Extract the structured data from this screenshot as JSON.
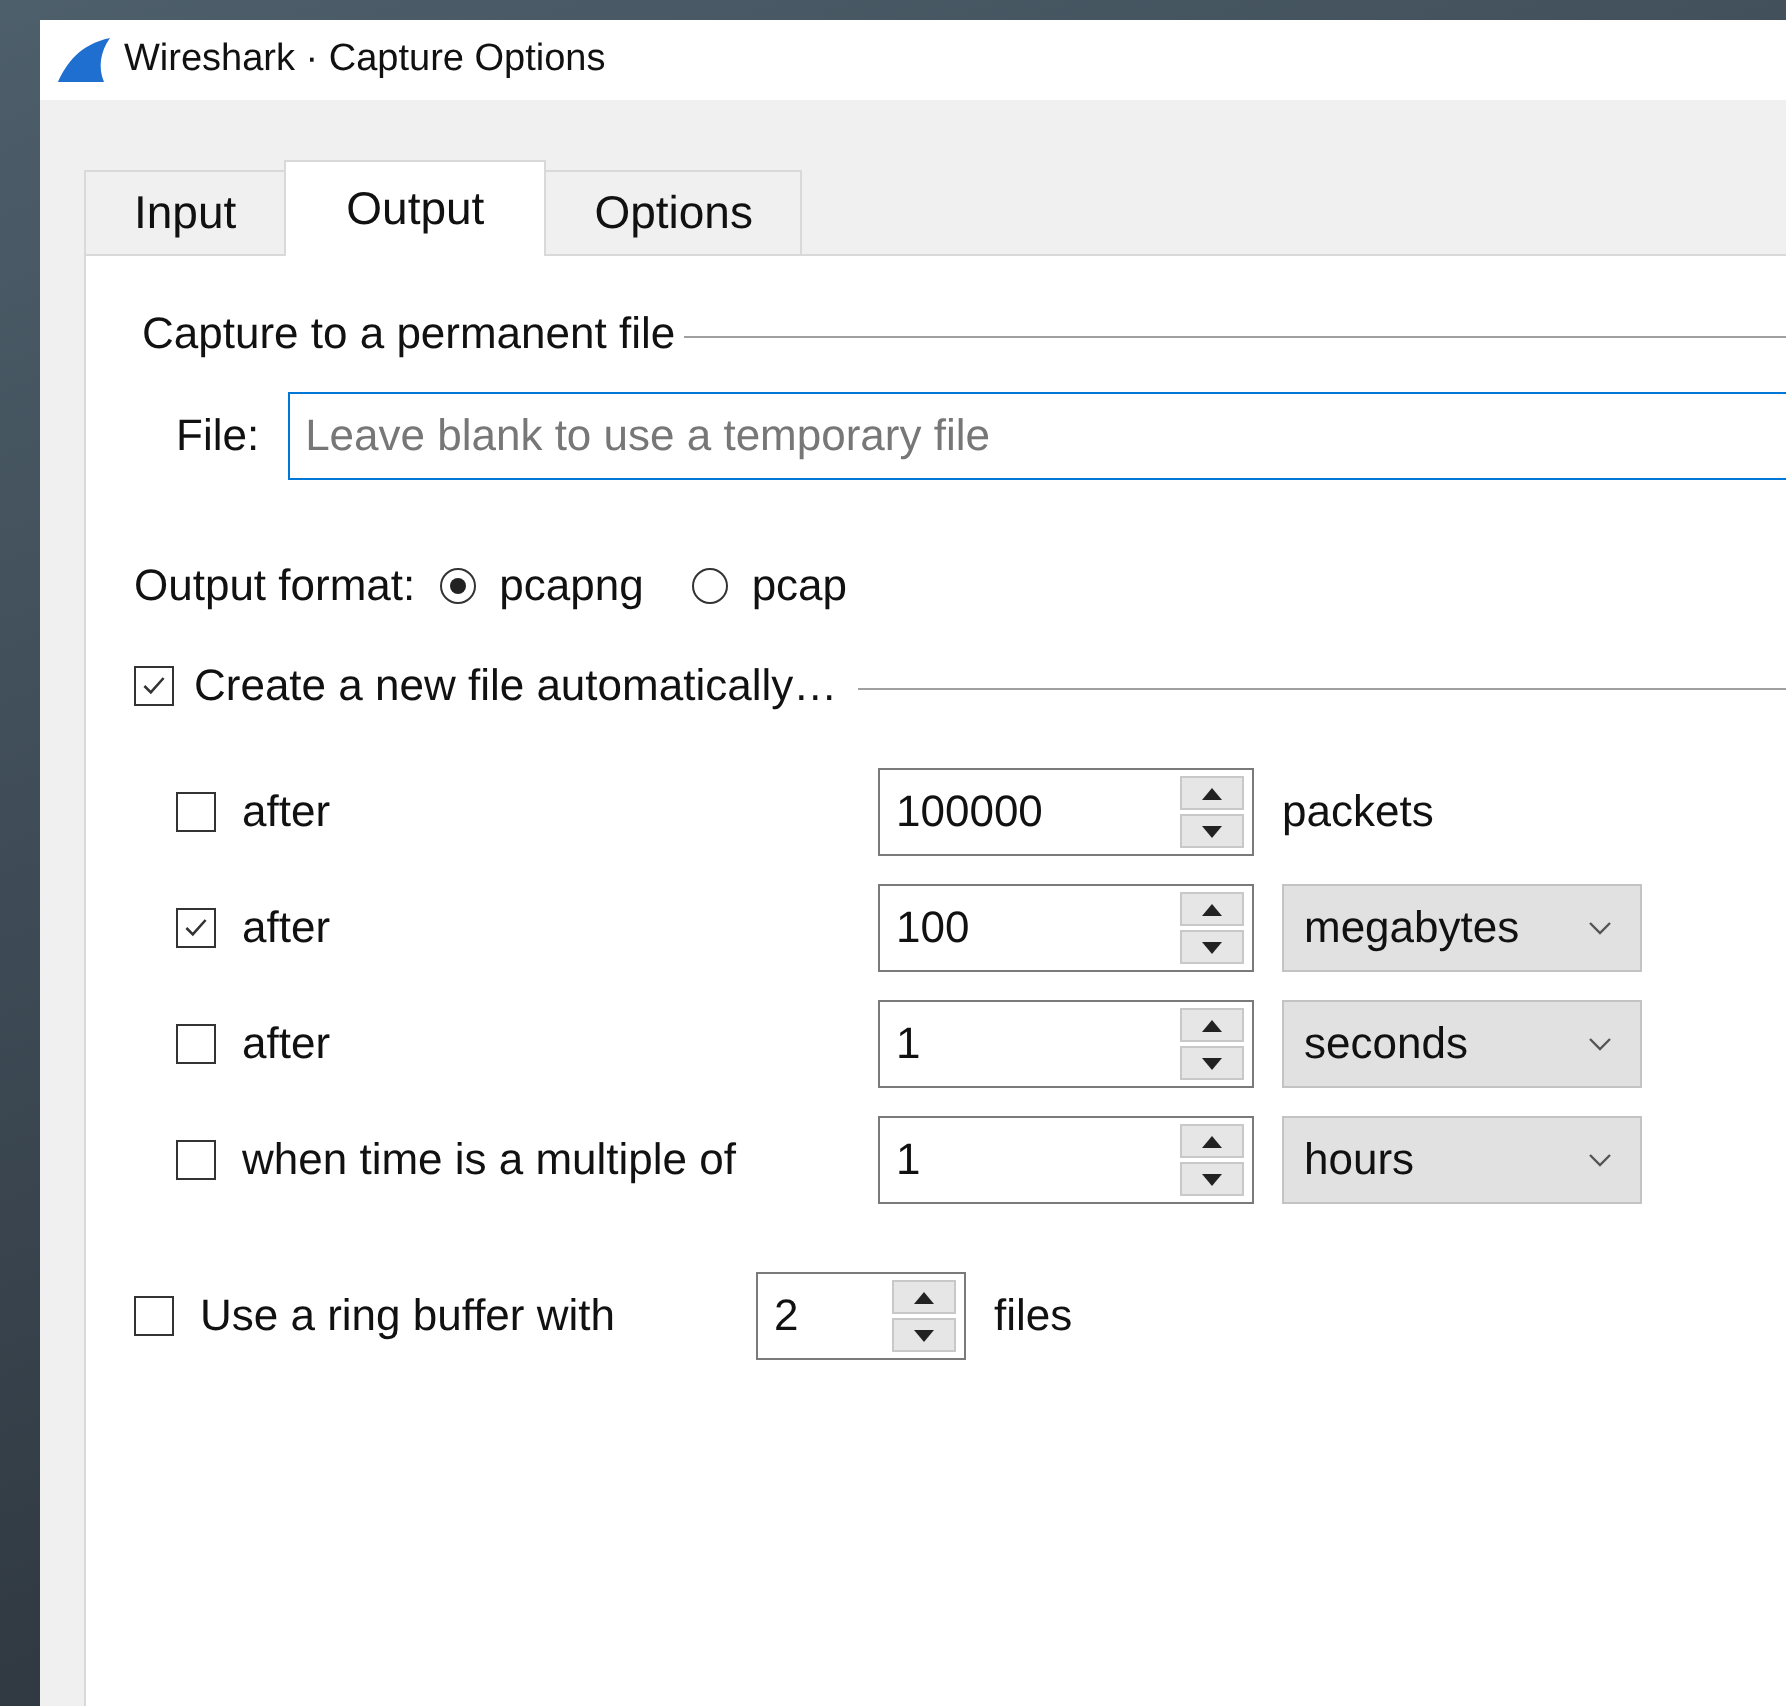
{
  "window": {
    "title": "Wireshark · Capture Options"
  },
  "tabs": [
    {
      "label": "Input",
      "selected": false
    },
    {
      "label": "Output",
      "selected": true
    },
    {
      "label": "Options",
      "selected": false
    }
  ],
  "capture_file": {
    "title": "Capture to a permanent file",
    "file": {
      "label": "File:",
      "placeholder": "Leave blank to use a temporary file"
    }
  },
  "output_format": {
    "label": "Output format:",
    "options": [
      {
        "label": "pcapng",
        "selected": true
      },
      {
        "label": "pcap",
        "selected": false
      }
    ]
  },
  "auto_new_file": {
    "label": "Create a new file automatically…",
    "checked": true,
    "conditions": [
      {
        "label": "after",
        "checked": false,
        "value": "100000",
        "unit": {
          "kind": "label",
          "text": "packets"
        }
      },
      {
        "label": "after",
        "checked": true,
        "value": "100",
        "unit": {
          "kind": "dropdown",
          "text": "megabytes"
        }
      },
      {
        "label": "after",
        "checked": false,
        "value": "1",
        "unit": {
          "kind": "dropdown",
          "text": "seconds"
        }
      },
      {
        "label": "when time is a multiple of",
        "checked": false,
        "value": "1",
        "unit": {
          "kind": "dropdown",
          "text": "hours"
        }
      }
    ]
  },
  "ring_buffer": {
    "label": "Use a ring buffer with",
    "checked": false,
    "value": "2",
    "suffix": "files"
  }
}
